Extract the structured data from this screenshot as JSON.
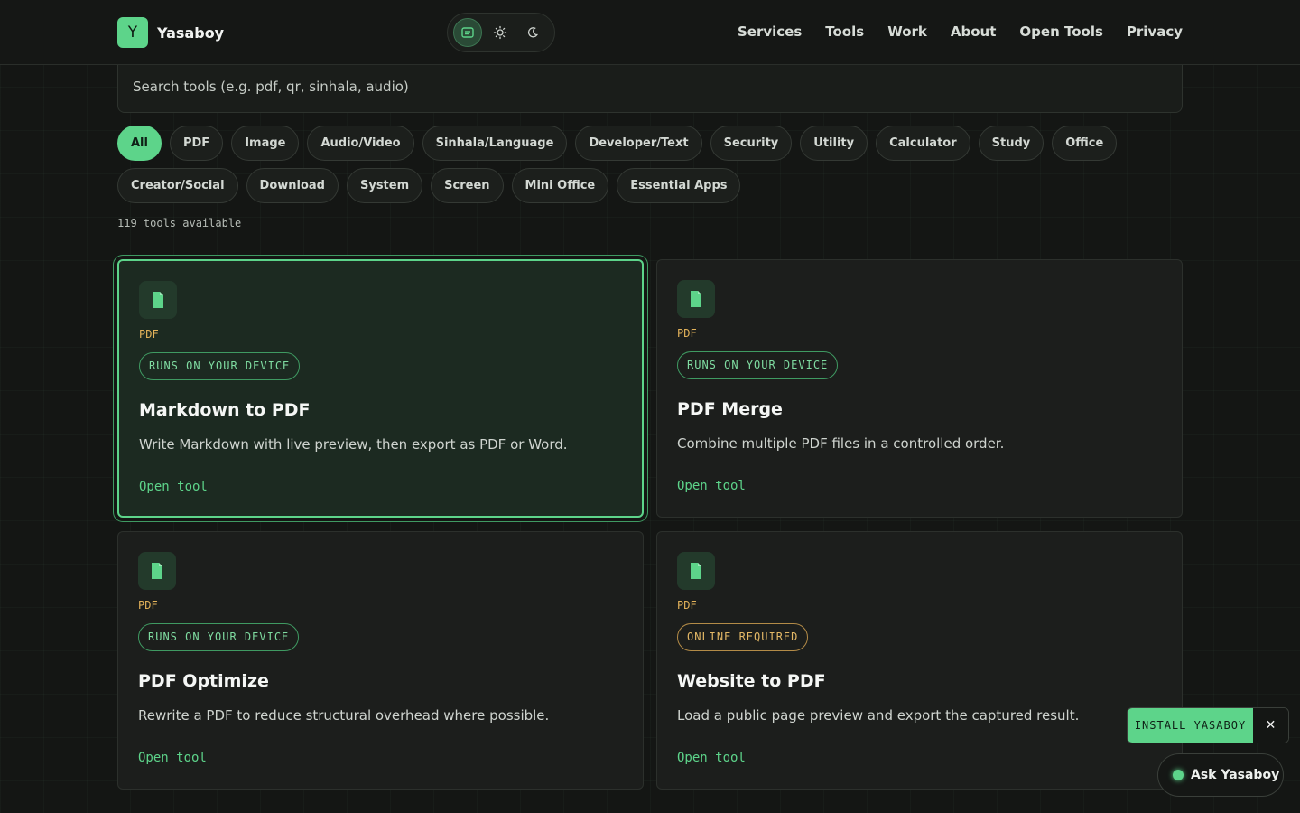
{
  "header": {
    "brand_letter": "Y",
    "brand_name": "Yasaboy",
    "theme_options": [
      "system-icon",
      "sun-icon",
      "moon-icon"
    ],
    "nav": [
      "Services",
      "Tools",
      "Work",
      "About",
      "Open Tools",
      "Privacy"
    ]
  },
  "search": {
    "placeholder": "Search tools (e.g. pdf, qr, sinhala, audio)"
  },
  "filters": {
    "active": "All",
    "items": [
      "All",
      "PDF",
      "Image",
      "Audio/Video",
      "Sinhala/Language",
      "Developer/Text",
      "Security",
      "Utility",
      "Calculator",
      "Study",
      "Office",
      "Creator/Social",
      "Download",
      "System",
      "Screen",
      "Mini Office",
      "Essential Apps"
    ]
  },
  "tool_count": "119 tools available",
  "cards": [
    {
      "icon": "file-icon",
      "category": "PDF",
      "badge": "RUNS ON YOUR DEVICE",
      "title": "Markdown to PDF",
      "description": "Write Markdown with live preview, then export as PDF or Word.",
      "cta": "Open tool"
    },
    {
      "icon": "file-icon",
      "category": "PDF",
      "badge": "RUNS ON YOUR DEVICE",
      "title": "PDF Merge",
      "description": "Combine multiple PDF files in a controlled order.",
      "cta": "Open tool"
    },
    {
      "icon": "file-icon",
      "category": "PDF",
      "badge": "RUNS ON YOUR DEVICE",
      "title": "PDF Optimize",
      "description": "Rewrite a PDF to reduce structural overhead where possible.",
      "cta": "Open tool"
    },
    {
      "icon": "file-icon",
      "category": "PDF",
      "badge": "ONLINE REQUIRED",
      "title": "Website to PDF",
      "description": "Load a public page preview and export the captured result.",
      "cta": "Open tool"
    }
  ],
  "install": {
    "label": "INSTALL YASABOY",
    "close": "✕"
  },
  "ask": {
    "label": "Ask Yasaboy"
  },
  "colors": {
    "accent": "#5dd48a",
    "background": "#141614",
    "category": "#e2b25a",
    "online_badge": "#e3b866"
  }
}
